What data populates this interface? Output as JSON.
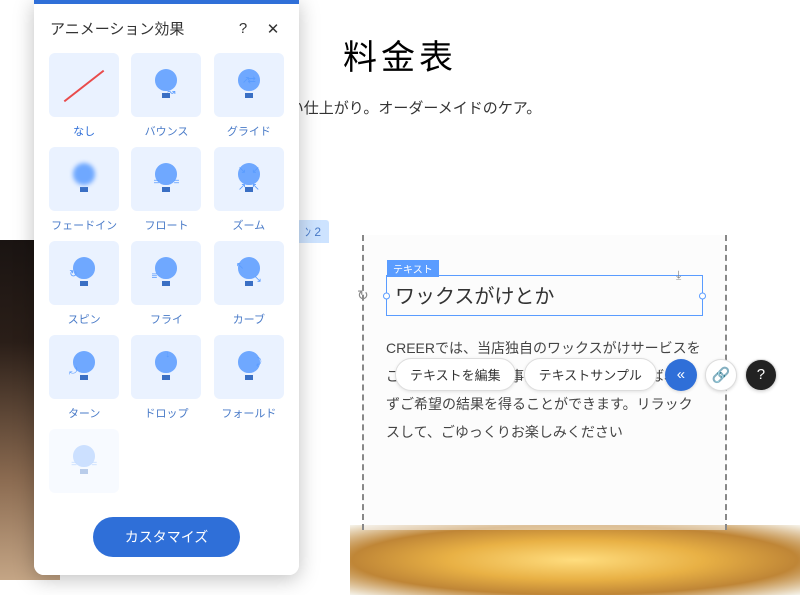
{
  "page": {
    "title": "料金表",
    "subtitle": "美しい仕上がり。オーダーメイドのケア。",
    "section_tab": "ﾝ 2"
  },
  "selected_text": {
    "badge": "テキスト",
    "content": "ワックスがけとか"
  },
  "body_text": "CREERでは、当店独自のワックスがけサービスをご提供しています。事前にご予約いただけば、必ずご希望の結果を得ることができます。リラックスして、ごゆっくりお楽しみください",
  "toolbar": {
    "edit_text": "テキストを編集",
    "text_sample": "テキストサンプル",
    "anim_icon": "«",
    "link_icon": "🔗",
    "help_icon": "?"
  },
  "panel": {
    "title": "アニメーション効果",
    "help": "?",
    "close": "✕",
    "customize": "カスタマイズ",
    "items": [
      {
        "label": "なし",
        "type": "none"
      },
      {
        "label": "バウンス",
        "type": "bounce"
      },
      {
        "label": "グライド",
        "type": "glide"
      },
      {
        "label": "フェードイン",
        "type": "fadein"
      },
      {
        "label": "フロート",
        "type": "float"
      },
      {
        "label": "ズーム",
        "type": "zoom"
      },
      {
        "label": "スピン",
        "type": "spin"
      },
      {
        "label": "フライ",
        "type": "fly"
      },
      {
        "label": "カーブ",
        "type": "curve"
      },
      {
        "label": "ターン",
        "type": "turn"
      },
      {
        "label": "ドロップ",
        "type": "drop"
      },
      {
        "label": "フォールド",
        "type": "fold"
      }
    ]
  }
}
